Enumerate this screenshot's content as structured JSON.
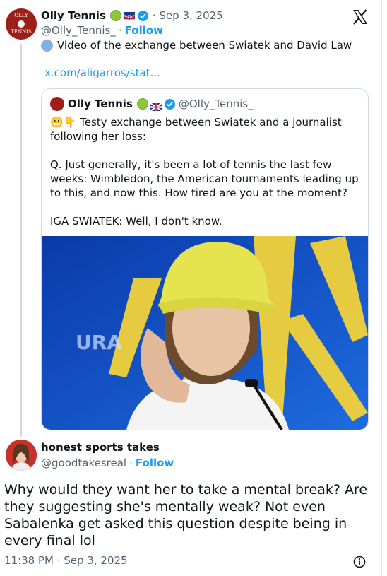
{
  "colors": {
    "brand_blue": "#1d9bf0",
    "muted": "#536471",
    "border": "#cfd9de",
    "photo_bg": "#1456c8"
  },
  "tweet": {
    "author": {
      "name": "Olly Tennis",
      "handle": "@Olly_Tennis_",
      "avatar_text_top": "OLLY",
      "avatar_text_bottom": "TENNIS"
    },
    "timestamp": "· Sep 3, 2025",
    "follow_label": "Follow",
    "text": "Video of the exchange between Swiatek and David Law",
    "link": "x.com/aligarros/stat...",
    "x_logo": "x-logo"
  },
  "quote": {
    "author": {
      "name": "Olly Tennis",
      "handle": "@Olly_Tennis_"
    },
    "emojis": "😬👇",
    "line1": "Testy exchange between Swiatek and a journalist following her loss:",
    "question": "Q. Just generally, it's been a lot of tennis the last few weeks: Wimbledon, the American tournaments leading up to this, and now this. How tired are you at the moment?",
    "answer": "IGA SWIATEK: Well, I don't know.",
    "photo_alt": "Iga Swiatek at press conference"
  },
  "reply": {
    "author": {
      "name": "honest sports takes",
      "handle": "@goodtakesreal"
    },
    "separator": "·",
    "follow_label": "Follow",
    "text": "Why would they want her to take a mental break? Are they suggesting she's mentally weak? Not even Sabalenka get asked this question despite being in every final lol",
    "timestamp": "11:38 PM · Sep 3, 2025"
  }
}
